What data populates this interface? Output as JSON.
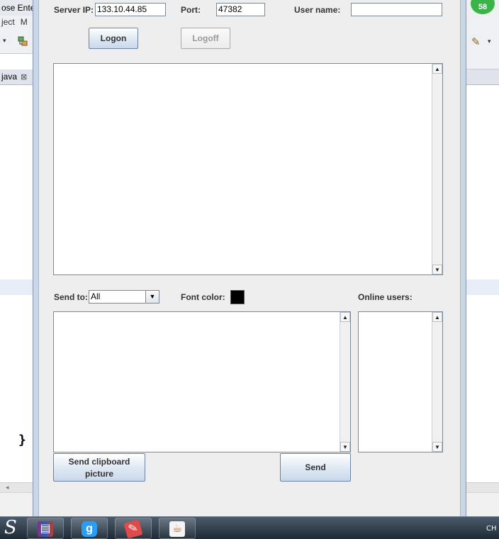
{
  "ide": {
    "title_fragment": "ose Enter",
    "menu": [
      "ject",
      "M"
    ],
    "tab_label": "java",
    "tab_close": "⊠",
    "code_brace": "}",
    "scroll_arrow": "◂"
  },
  "notification": {
    "count": "58"
  },
  "connection": {
    "server_ip_label": "Server  IP:",
    "server_ip_value": "133.10.44.85",
    "port_label": "Port:",
    "port_value": "47382",
    "username_label": "User name:",
    "username_value": "",
    "logon_label": "Logon",
    "logoff_label": "Logoff"
  },
  "compose": {
    "send_to_label": "Send to:",
    "send_to_value": "All",
    "font_color_label": "Font color:",
    "font_color": "#000000",
    "online_users_label": "Online users:",
    "message_text": "",
    "send_clipboard_line1": "Send clipboard",
    "send_clipboard_line2": "picture",
    "send_label": "Send"
  },
  "taskbar": {
    "lang": "CH",
    "icons": [
      "start-logo-icon",
      "winrar-icon",
      "qq-pinyin-icon",
      "notepad-add-icon",
      "java-icon"
    ]
  }
}
